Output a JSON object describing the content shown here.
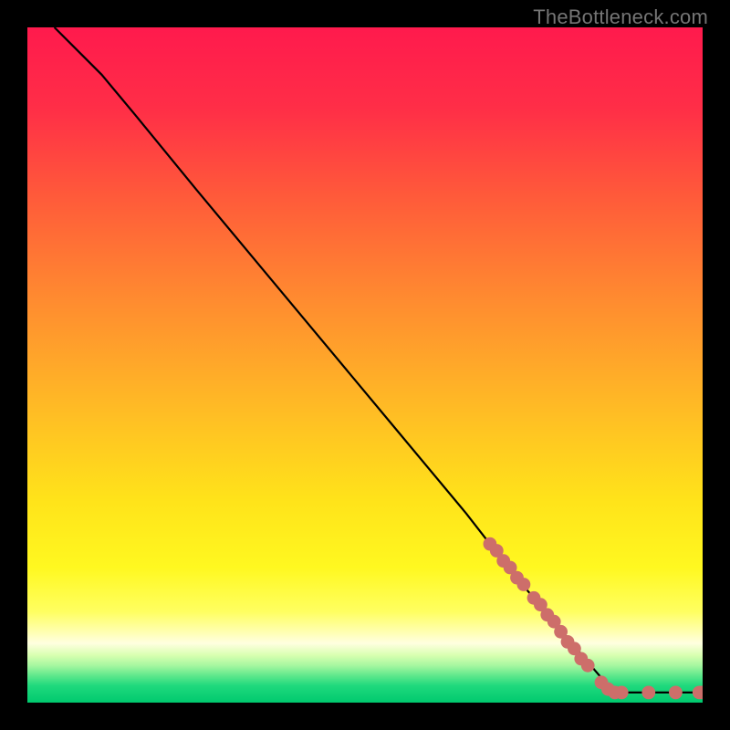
{
  "attribution": "TheBottleneck.com",
  "chart_data": {
    "type": "line",
    "title": "",
    "xlabel": "",
    "ylabel": "",
    "xlim": [
      0,
      100
    ],
    "ylim": [
      0,
      100
    ],
    "curve": [
      {
        "x": 4,
        "y": 100
      },
      {
        "x": 7,
        "y": 97
      },
      {
        "x": 11,
        "y": 93
      },
      {
        "x": 16,
        "y": 87
      },
      {
        "x": 25,
        "y": 76
      },
      {
        "x": 35,
        "y": 64
      },
      {
        "x": 45,
        "y": 52
      },
      {
        "x": 55,
        "y": 40
      },
      {
        "x": 65,
        "y": 28
      },
      {
        "x": 72,
        "y": 19
      },
      {
        "x": 78,
        "y": 12
      },
      {
        "x": 83,
        "y": 6
      },
      {
        "x": 86,
        "y": 2.5
      },
      {
        "x": 88,
        "y": 1.5
      },
      {
        "x": 92,
        "y": 1.5
      },
      {
        "x": 96,
        "y": 1.5
      },
      {
        "x": 100,
        "y": 1.5
      }
    ],
    "markers": [
      {
        "x": 68.5,
        "y": 23.5
      },
      {
        "x": 69.5,
        "y": 22.5
      },
      {
        "x": 70.5,
        "y": 21
      },
      {
        "x": 71.5,
        "y": 20
      },
      {
        "x": 72.5,
        "y": 18.5
      },
      {
        "x": 73.5,
        "y": 17.5
      },
      {
        "x": 75,
        "y": 15.5
      },
      {
        "x": 76,
        "y": 14.5
      },
      {
        "x": 77,
        "y": 13
      },
      {
        "x": 78,
        "y": 12
      },
      {
        "x": 79,
        "y": 10.5
      },
      {
        "x": 80,
        "y": 9
      },
      {
        "x": 81,
        "y": 8
      },
      {
        "x": 82,
        "y": 6.5
      },
      {
        "x": 83,
        "y": 5.5
      },
      {
        "x": 85,
        "y": 3
      },
      {
        "x": 86,
        "y": 2
      },
      {
        "x": 87,
        "y": 1.5
      },
      {
        "x": 88,
        "y": 1.5
      },
      {
        "x": 92,
        "y": 1.5
      },
      {
        "x": 96,
        "y": 1.5
      },
      {
        "x": 99.5,
        "y": 1.5
      },
      {
        "x": 100,
        "y": 1.5
      }
    ],
    "marker_color": "#cd6e6a",
    "marker_radius_pct": 1.0,
    "curve_color": "#000000",
    "gradient_stops": [
      {
        "pos": 0.0,
        "color": "#ff1a4d"
      },
      {
        "pos": 0.12,
        "color": "#ff2e47"
      },
      {
        "pos": 0.25,
        "color": "#ff5a3a"
      },
      {
        "pos": 0.4,
        "color": "#ff8a30"
      },
      {
        "pos": 0.55,
        "color": "#ffb726"
      },
      {
        "pos": 0.7,
        "color": "#ffe31a"
      },
      {
        "pos": 0.8,
        "color": "#fff820"
      },
      {
        "pos": 0.865,
        "color": "#ffff60"
      },
      {
        "pos": 0.895,
        "color": "#ffffb0"
      },
      {
        "pos": 0.912,
        "color": "#ffffe0"
      },
      {
        "pos": 0.93,
        "color": "#d8ffb0"
      },
      {
        "pos": 0.945,
        "color": "#a6f7a0"
      },
      {
        "pos": 0.96,
        "color": "#5fe88c"
      },
      {
        "pos": 0.975,
        "color": "#1fd97d"
      },
      {
        "pos": 1.0,
        "color": "#00c96e"
      }
    ]
  }
}
